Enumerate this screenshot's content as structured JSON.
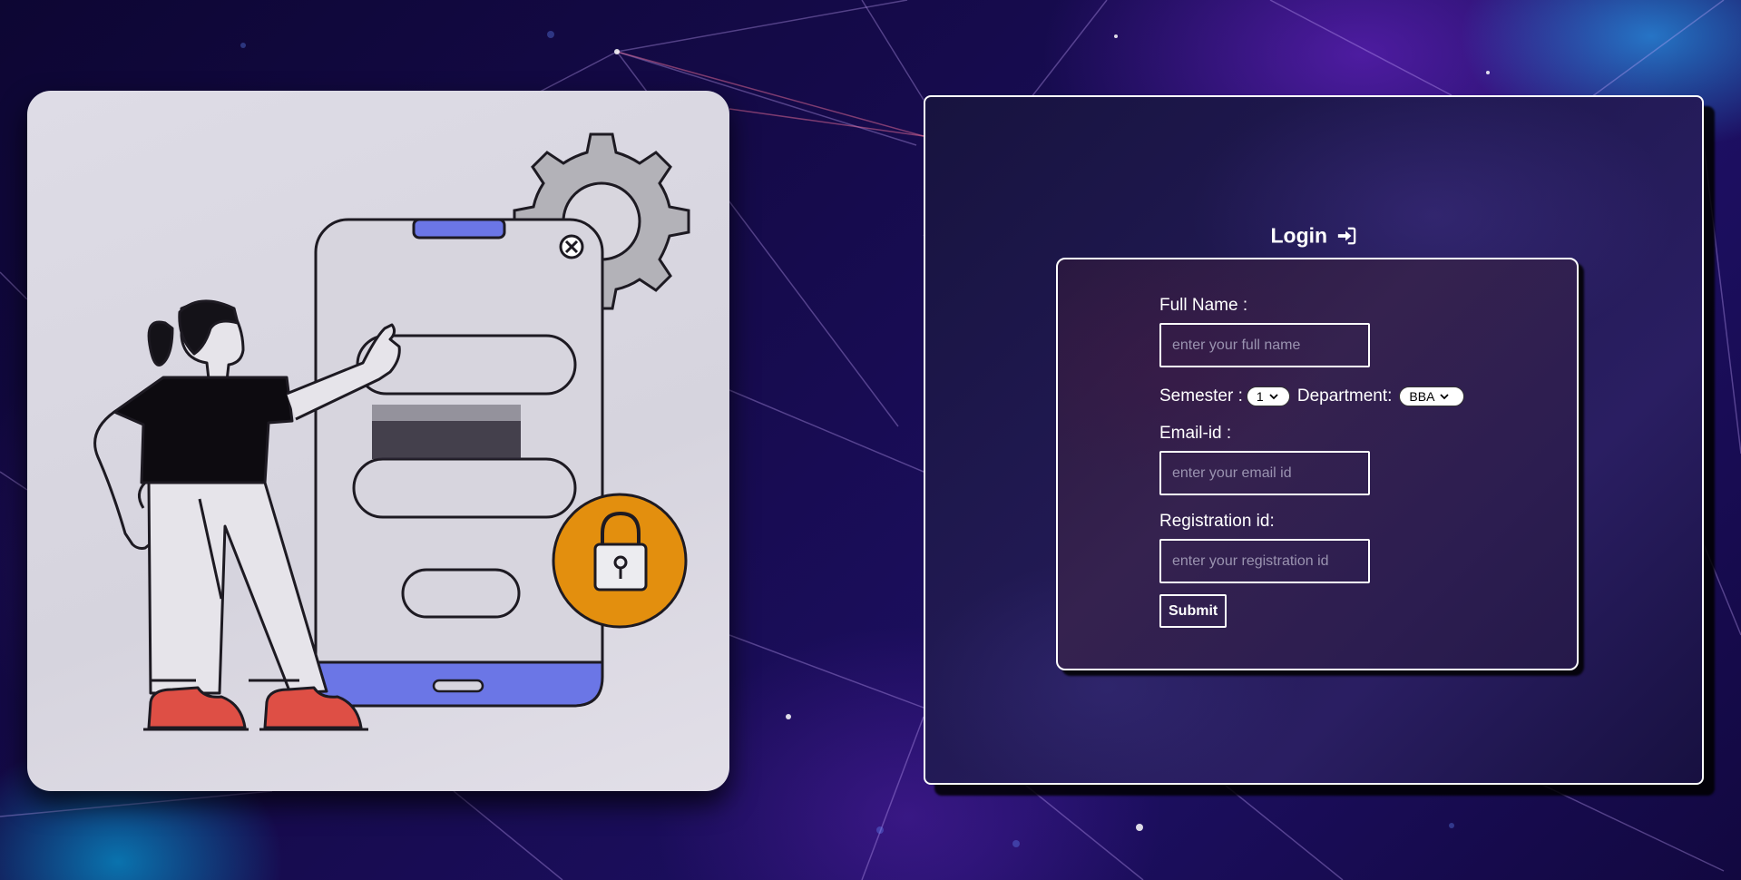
{
  "login": {
    "title": "Login",
    "title_icon": "sign-in-icon"
  },
  "form": {
    "full_name": {
      "label": "Full Name :",
      "placeholder": "enter your full name",
      "value": ""
    },
    "semester": {
      "label": "Semester :",
      "selected": "1"
    },
    "department": {
      "label": "Department:",
      "selected": "BBA"
    },
    "email": {
      "label": "Email-id :",
      "placeholder": "enter your email id",
      "value": ""
    },
    "registration": {
      "label": "Registration id:",
      "placeholder": "enter your registration id",
      "value": ""
    },
    "submit_label": "Submit"
  },
  "illustration": {
    "subject": "person-pointing-at-phone-login-illustration",
    "icons": [
      "gear-icon",
      "close-icon",
      "padlock-icon"
    ]
  },
  "colors": {
    "background": "#160b4d",
    "panel_border": "#ffffff",
    "phone_accent": "#6b76e6",
    "lock_badge": "#e38f0e",
    "shoe": "#de4f45"
  }
}
